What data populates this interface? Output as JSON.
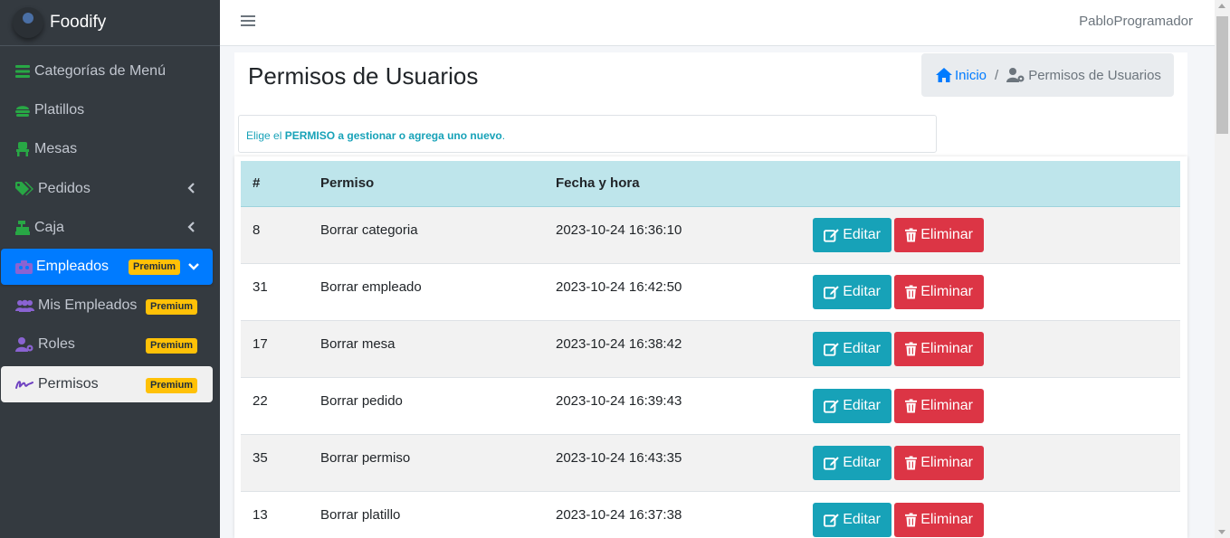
{
  "brand": {
    "name": "Foodify"
  },
  "sidebar": {
    "items": [
      {
        "label": "Categorías de Menú"
      },
      {
        "label": "Platillos"
      },
      {
        "label": "Mesas"
      },
      {
        "label": "Pedidos"
      },
      {
        "label": "Caja"
      },
      {
        "label": "Empleados",
        "badge": "Premium"
      },
      {
        "label": "Mis Empleados",
        "badge": "Premium"
      },
      {
        "label": "Roles",
        "badge": "Premium"
      },
      {
        "label": "Permisos",
        "badge": "Premium"
      }
    ]
  },
  "topbar": {
    "username": "PabloProgramador"
  },
  "page": {
    "title": "Permisos de Usuarios"
  },
  "breadcrumb": {
    "home": "Inicio",
    "separator": "/",
    "current": "Permisos de Usuarios"
  },
  "info": {
    "prefix": "Elige el ",
    "strong": "PERMISO",
    "suffix": " a gestionar o agrega uno nuevo",
    "end": "."
  },
  "table": {
    "headers": [
      "#",
      "Permiso",
      "Fecha y hora"
    ],
    "edit_label": "Editar",
    "delete_label": "Eliminar",
    "rows": [
      {
        "id": "8",
        "permiso": "Borrar categoria",
        "fecha": "2023-10-24 16:36:10"
      },
      {
        "id": "31",
        "permiso": "Borrar empleado",
        "fecha": "2023-10-24 16:42:50"
      },
      {
        "id": "17",
        "permiso": "Borrar mesa",
        "fecha": "2023-10-24 16:38:42"
      },
      {
        "id": "22",
        "permiso": "Borrar pedido",
        "fecha": "2023-10-24 16:39:43"
      },
      {
        "id": "35",
        "permiso": "Borrar permiso",
        "fecha": "2023-10-24 16:43:35"
      },
      {
        "id": "13",
        "permiso": "Borrar platillo",
        "fecha": "2023-10-24 16:37:38"
      }
    ]
  },
  "colors": {
    "primary": "#007bff",
    "info": "#17a2b8",
    "danger": "#dc3545",
    "warning": "#ffc107",
    "sidebar": "#343a40"
  },
  "icons": [
    "bars-icon",
    "hamburger-icon",
    "home-icon",
    "user-cog-icon",
    "edit-icon",
    "trash-icon",
    "chevron-left-icon",
    "chevron-down-icon"
  ]
}
